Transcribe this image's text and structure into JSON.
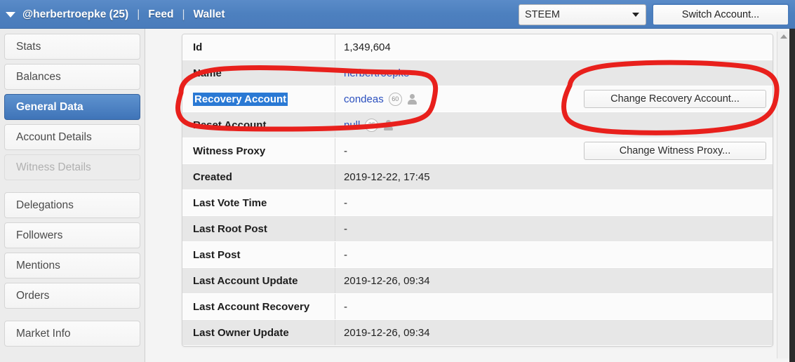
{
  "topbar": {
    "caret_icon": "caret-down-icon",
    "account": "@herbertroepke (25)",
    "separator": "|",
    "feed_label": "Feed",
    "wallet_label": "Wallet",
    "network_value": "STEEM",
    "network_caret_icon": "select-caret-icon",
    "switch_account_label": "Switch Account...",
    "bg_color": "#4d80bf",
    "text_color": "#ffffff"
  },
  "sidebar": {
    "items": [
      {
        "label": "Stats",
        "state": "normal"
      },
      {
        "label": "Balances",
        "state": "normal"
      },
      {
        "label": "General Data",
        "state": "active"
      },
      {
        "label": "Account Details",
        "state": "normal"
      },
      {
        "label": "Witness Details",
        "state": "disabled"
      },
      {
        "label": "Delegations",
        "state": "normal"
      },
      {
        "label": "Followers",
        "state": "normal"
      },
      {
        "label": "Mentions",
        "state": "normal"
      },
      {
        "label": "Orders",
        "state": "normal"
      },
      {
        "label": "Market Info",
        "state": "normal"
      }
    ],
    "active_bg": "#4a7cbb"
  },
  "table": {
    "rows": [
      {
        "label": "Id",
        "value": "1,349,604",
        "kind": "text"
      },
      {
        "label": "Name",
        "value": "herbertroepke",
        "kind": "link"
      },
      {
        "label": "Recovery Account",
        "value": "condeas",
        "kind": "account",
        "reputation": "60",
        "label_selected": true,
        "action": "Change Recovery Account..."
      },
      {
        "label": "Reset Account",
        "value": "null",
        "kind": "account",
        "reputation": "25"
      },
      {
        "label": "Witness Proxy",
        "value": "-",
        "kind": "text",
        "action": "Change Witness Proxy..."
      },
      {
        "label": "Created",
        "value": "2019-12-22, 17:45",
        "kind": "text"
      },
      {
        "label": "Last Vote Time",
        "value": "-",
        "kind": "text"
      },
      {
        "label": "Last Root Post",
        "value": "-",
        "kind": "text"
      },
      {
        "label": "Last Post",
        "value": "-",
        "kind": "text"
      },
      {
        "label": "Last Account Update",
        "value": "2019-12-26, 09:34",
        "kind": "text"
      },
      {
        "label": "Last Account Recovery",
        "value": "-",
        "kind": "text"
      },
      {
        "label": "Last Owner Update",
        "value": "2019-12-26, 09:34",
        "kind": "text"
      }
    ]
  },
  "scrollbar": {
    "up_arrow_icon": "scroll-up-arrow-icon"
  },
  "annotations": {
    "color": "#e8201c",
    "shapes": [
      {
        "name": "recovery-account-row-circle"
      },
      {
        "name": "change-recovery-account-button-circle"
      }
    ]
  }
}
